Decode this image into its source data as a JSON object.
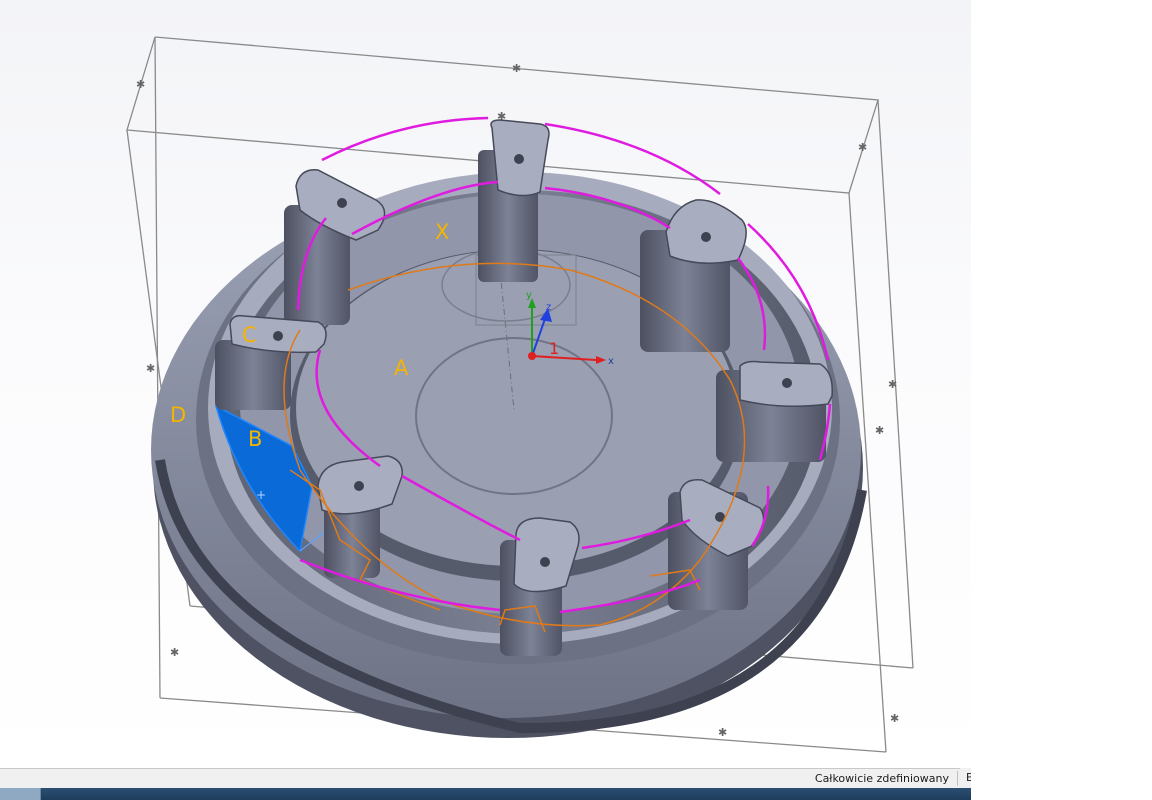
{
  "viewport": {
    "labels": {
      "x": "X",
      "a": "A",
      "b": "B",
      "c": "C",
      "d": "D"
    },
    "triad": {
      "x_label": "x",
      "y_label": "y",
      "z_label": "z",
      "origin_label": "1"
    }
  },
  "status_bar": {
    "status_text": "Całkowicie zdefiniowany",
    "extra_cell": "E"
  },
  "colors": {
    "sketch_magenta": "#e01be0",
    "edge_orange": "#e07a18",
    "selection_blue": "#0a6ad8",
    "label_yellow": "#f5b400",
    "model_gray": "#8f95aa"
  }
}
